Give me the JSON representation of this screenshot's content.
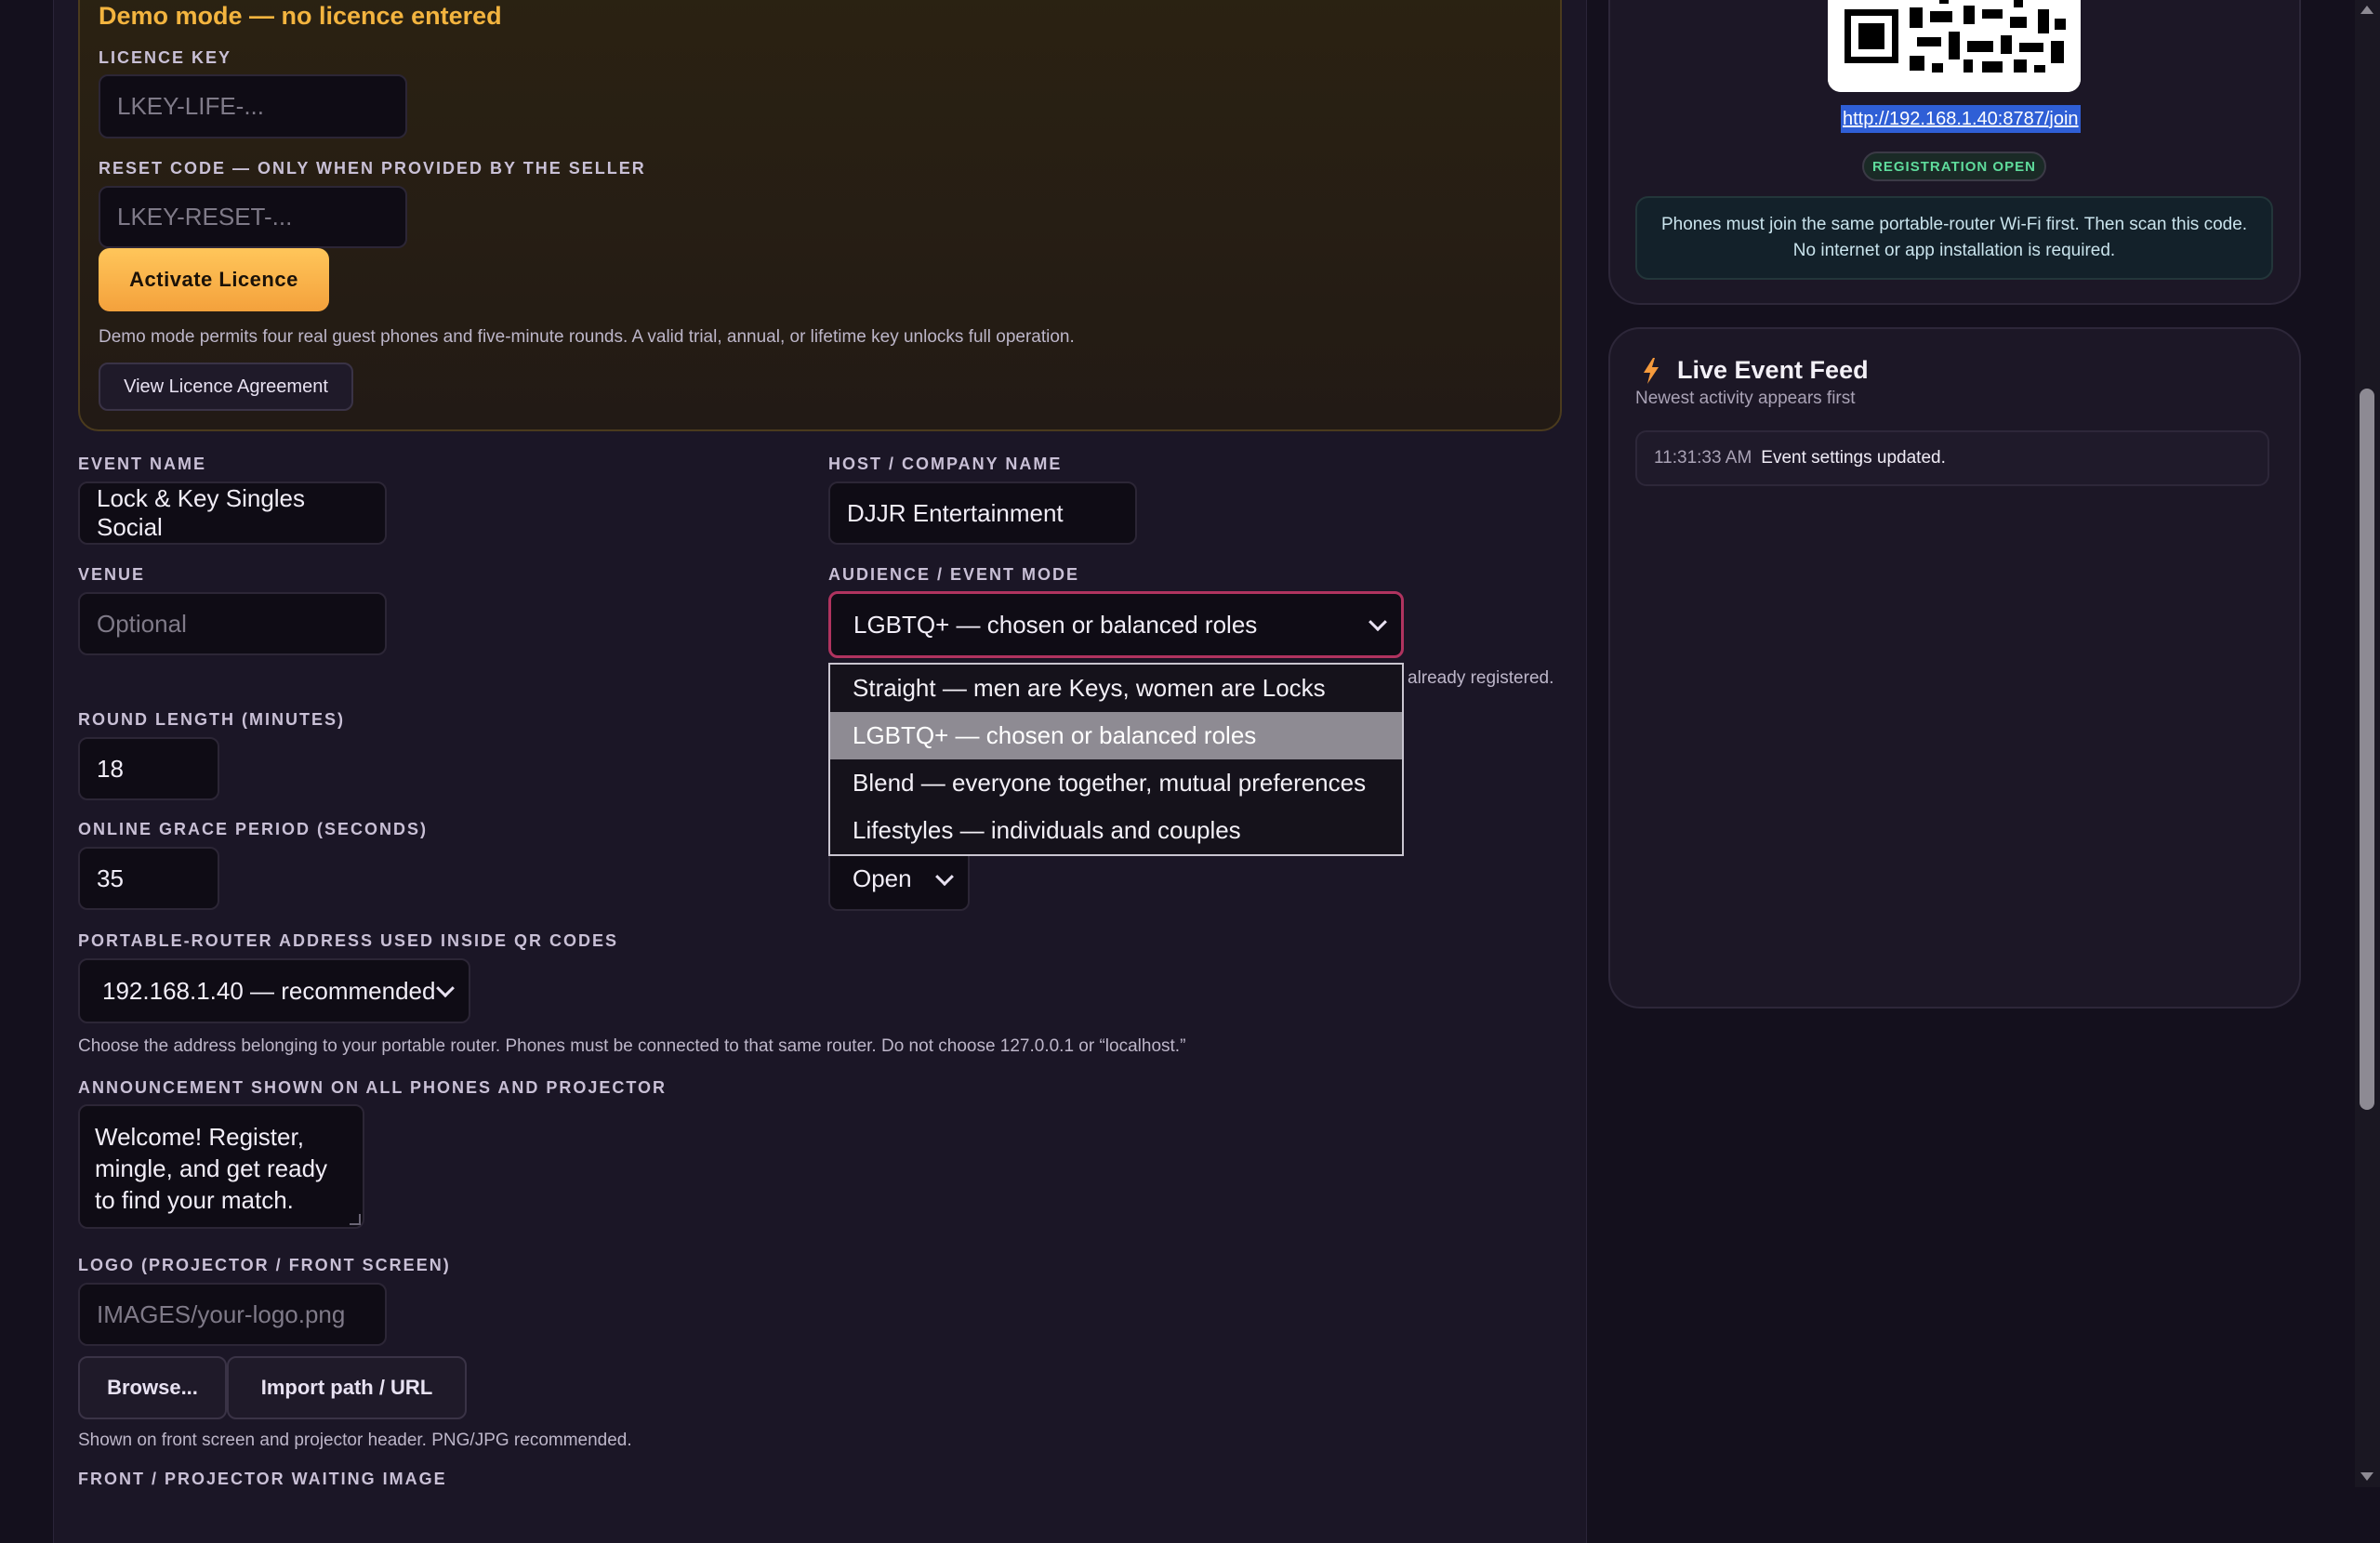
{
  "licence": {
    "demo_title": "Demo mode — no licence entered",
    "key_label": "LICENCE KEY",
    "key_placeholder": "LKEY-LIFE-...",
    "reset_label": "RESET CODE — ONLY WHEN PROVIDED BY THE SELLER",
    "reset_placeholder": "LKEY-RESET-...",
    "activate_button": "Activate Licence",
    "demo_note": "Demo mode permits four real guest phones and five-minute rounds. A valid trial, annual, or lifetime key unlocks full operation.",
    "agreement_button": "View Licence Agreement"
  },
  "form": {
    "event_name_label": "EVENT NAME",
    "event_name_value": "Lock & Key Singles Social",
    "host_label": "HOST / COMPANY NAME",
    "host_value": "DJJR Entertainment",
    "venue_label": "VENUE",
    "venue_placeholder": "Optional",
    "audience_label": "AUDIENCE / EVENT MODE",
    "audience_value": "LGBTQ+ — chosen or balanced roles",
    "audience_hint_tail": "already registered.",
    "audience_options": [
      "Straight — men are Keys, women are Locks",
      "LGBTQ+ — chosen or balanced roles",
      "Blend — everyone together, mutual preferences",
      "Lifestyles — individuals and couples"
    ],
    "round_length_label": "ROUND LENGTH (MINUTES)",
    "round_length_value": "18",
    "grace_label": "ONLINE GRACE PERIOD (SECONDS)",
    "grace_value": "35",
    "registration_select_value": "Open",
    "router_label": "PORTABLE-ROUTER ADDRESS USED INSIDE QR CODES",
    "router_value": "192.168.1.40 — recommended",
    "router_hint": "Choose the address belonging to your portable router. Phones must be connected to that same router. Do not choose 127.0.0.1 or “localhost.”",
    "announcement_label": "ANNOUNCEMENT SHOWN ON ALL PHONES AND PROJECTOR",
    "announcement_lines": [
      "Welcome! Register,",
      "mingle, and get ready",
      "to find your match."
    ],
    "logo_label": "LOGO (PROJECTOR / FRONT SCREEN)",
    "logo_placeholder": "IMAGES/your-logo.png",
    "browse_button": "Browse...",
    "import_button": "Import path / URL",
    "logo_hint": "Shown on front screen and projector header. PNG/JPG recommended.",
    "waiting_image_label": "FRONT / PROJECTOR WAITING IMAGE"
  },
  "qr_panel": {
    "join_url": "http://192.168.1.40:8787/join",
    "status_badge": "REGISTRATION OPEN",
    "instructions_line1": "Phones must join the same portable-router Wi-Fi first. Then scan this code.",
    "instructions_line2": "No internet or app installation is required."
  },
  "feed": {
    "title": "Live Event Feed",
    "subtitle": "Newest activity appears first",
    "items": [
      {
        "time": "11:31:33 AM",
        "message": "Event settings updated."
      }
    ]
  },
  "colors": {
    "background": "#14101d",
    "accent_gold": "#f3b43f",
    "status_green": "#5fdc9c",
    "link_highlight": "#2f5fd6",
    "focus_border": "#b0335f"
  }
}
